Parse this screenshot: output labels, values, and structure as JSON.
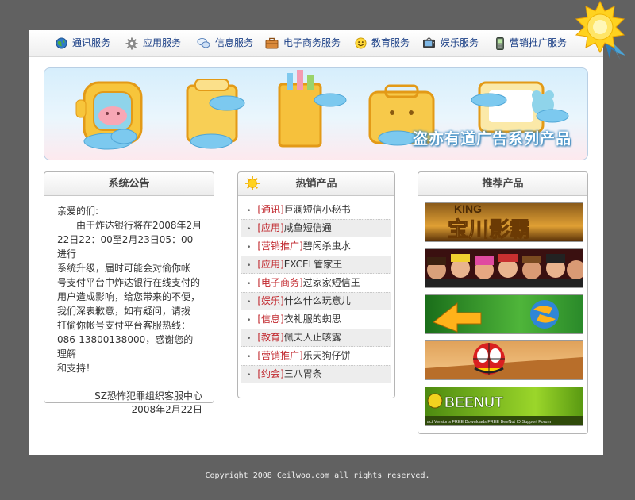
{
  "nav": {
    "items": [
      {
        "label": "通讯服务",
        "icon": "globe-icon"
      },
      {
        "label": "应用服务",
        "icon": "gear-icon"
      },
      {
        "label": "信息服务",
        "icon": "chat-bubbles-icon"
      },
      {
        "label": "电子商务服务",
        "icon": "briefcase-icon"
      },
      {
        "label": "教育服务",
        "icon": "smiley-icon"
      },
      {
        "label": "娱乐服务",
        "icon": "tv-icon"
      },
      {
        "label": "营销推广服务",
        "icon": "mobile-phone-icon"
      }
    ]
  },
  "banner": {
    "title": "盗亦有道广告系列产品"
  },
  "notice": {
    "title": "系统公告",
    "greeting": "亲爱的们:",
    "lines": [
      "由于炸达银行将在2008年2月",
      "22日22：00至2月23日05：00进行",
      "系统升级，届时可能会对偷你帐",
      "号支付平台中炸达银行在线支付的",
      "用户造成影响，给您带来的不便，",
      "我们深表歉意，如有疑问，请拨",
      "打偷你帐号支付平台客服热线：",
      "086-13800138000，感谢您的理解",
      "和支持！"
    ],
    "signature": "SZ恐怖犯罪组织客服中心",
    "date": "2008年2月22日"
  },
  "hot": {
    "title": "热销产品",
    "items": [
      {
        "cat": "[通讯]",
        "name": "巨澜短信小秘书"
      },
      {
        "cat": "[应用]",
        "name": "咸鱼短信通"
      },
      {
        "cat": "[营销推广]",
        "name": "碧闲杀虫水"
      },
      {
        "cat": "[应用]",
        "name": "EXCEL管家王"
      },
      {
        "cat": "[电子商务]",
        "name": "过家家短信王"
      },
      {
        "cat": "[娱乐]",
        "name": "什么什么玩意儿"
      },
      {
        "cat": "[信息]",
        "name": "衣礼服的蜘思"
      },
      {
        "cat": "[教育]",
        "name": "佩夫人止咳露"
      },
      {
        "cat": "[营销推广]",
        "name": "乐天狗仔饼"
      },
      {
        "cat": "[约会]",
        "name": "三八胃条"
      }
    ]
  },
  "recommend": {
    "title": "推荐产品",
    "thumbs": [
      {
        "caption": "宝川影霸",
        "top_text": "KING"
      },
      {
        "caption": ""
      },
      {
        "caption": ""
      },
      {
        "caption": ""
      },
      {
        "caption": "BEENUT",
        "sub": "act   Versions   FREE Downloads   FREE BeeNut ID   Support Forum"
      }
    ]
  },
  "footer": {
    "text": "Copyright 2008 Ceilwoo.com all rights reserved."
  },
  "colors": {
    "background": "#616161",
    "nav_text": "#1a3f86",
    "category_red": "#c1272d",
    "banner_border": "#b9cfe4"
  }
}
